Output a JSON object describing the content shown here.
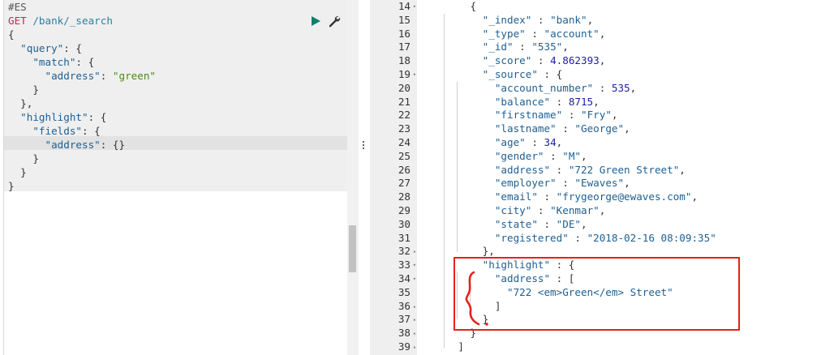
{
  "left_editor": {
    "lines": [
      [
        {
          "t": "#ES",
          "c": "comment"
        }
      ],
      [
        {
          "t": "GET",
          "c": "method"
        },
        {
          "t": " /bank/_search",
          "c": "url"
        }
      ],
      [
        {
          "t": "{",
          "c": "punc"
        }
      ],
      [
        {
          "t": "  \"query\"",
          "c": "key"
        },
        {
          "t": ": {",
          "c": "punc"
        }
      ],
      [
        {
          "t": "    \"match\"",
          "c": "key"
        },
        {
          "t": ": {",
          "c": "punc"
        }
      ],
      [
        {
          "t": "      \"address\"",
          "c": "key"
        },
        {
          "t": ": ",
          "c": "punc"
        },
        {
          "t": "\"green\"",
          "c": "str"
        }
      ],
      [
        {
          "t": "    }",
          "c": "punc"
        }
      ],
      [
        {
          "t": "  },",
          "c": "punc"
        }
      ],
      [
        {
          "t": "  \"highlight\"",
          "c": "key"
        },
        {
          "t": ": {",
          "c": "punc"
        }
      ],
      [
        {
          "t": "    \"fields\"",
          "c": "key"
        },
        {
          "t": ": {",
          "c": "punc"
        }
      ],
      [
        {
          "t": "      \"address\"",
          "c": "key"
        },
        {
          "t": ": {}",
          "c": "punc"
        }
      ],
      [
        {
          "t": "    }",
          "c": "punc"
        }
      ],
      [
        {
          "t": "  }",
          "c": "punc"
        }
      ],
      [
        {
          "t": "}",
          "c": "punc"
        }
      ]
    ],
    "run_icon": "play-icon",
    "settings_icon": "wrench-icon"
  },
  "right_editor": {
    "lines": [
      {
        "n": "14",
        "fold": "▾",
        "segs": [
          {
            "t": "      {",
            "c": "punc"
          }
        ]
      },
      {
        "n": "15",
        "fold": "",
        "segs": [
          {
            "t": "        \"_index\"",
            "c": "key"
          },
          {
            "t": " : ",
            "c": "punc"
          },
          {
            "t": "\"bank\"",
            "c": "str"
          },
          {
            "t": ",",
            "c": "punc"
          }
        ]
      },
      {
        "n": "16",
        "fold": "",
        "segs": [
          {
            "t": "        \"_type\"",
            "c": "key"
          },
          {
            "t": " : ",
            "c": "punc"
          },
          {
            "t": "\"account\"",
            "c": "str"
          },
          {
            "t": ",",
            "c": "punc"
          }
        ]
      },
      {
        "n": "17",
        "fold": "",
        "segs": [
          {
            "t": "        \"_id\"",
            "c": "key"
          },
          {
            "t": " : ",
            "c": "punc"
          },
          {
            "t": "\"535\"",
            "c": "str"
          },
          {
            "t": ",",
            "c": "punc"
          }
        ]
      },
      {
        "n": "18",
        "fold": "",
        "segs": [
          {
            "t": "        \"_score\"",
            "c": "key"
          },
          {
            "t": " : ",
            "c": "punc"
          },
          {
            "t": "4.862393",
            "c": "num"
          },
          {
            "t": ",",
            "c": "punc"
          }
        ]
      },
      {
        "n": "19",
        "fold": "▾",
        "segs": [
          {
            "t": "        \"_source\"",
            "c": "key"
          },
          {
            "t": " : {",
            "c": "punc"
          }
        ]
      },
      {
        "n": "20",
        "fold": "",
        "segs": [
          {
            "t": "          \"account_number\"",
            "c": "key"
          },
          {
            "t": " : ",
            "c": "punc"
          },
          {
            "t": "535",
            "c": "num"
          },
          {
            "t": ",",
            "c": "punc"
          }
        ]
      },
      {
        "n": "21",
        "fold": "",
        "segs": [
          {
            "t": "          \"balance\"",
            "c": "key"
          },
          {
            "t": " : ",
            "c": "punc"
          },
          {
            "t": "8715",
            "c": "num"
          },
          {
            "t": ",",
            "c": "punc"
          }
        ]
      },
      {
        "n": "22",
        "fold": "",
        "segs": [
          {
            "t": "          \"firstname\"",
            "c": "key"
          },
          {
            "t": " : ",
            "c": "punc"
          },
          {
            "t": "\"Fry\"",
            "c": "str"
          },
          {
            "t": ",",
            "c": "punc"
          }
        ]
      },
      {
        "n": "23",
        "fold": "",
        "segs": [
          {
            "t": "          \"lastname\"",
            "c": "key"
          },
          {
            "t": " : ",
            "c": "punc"
          },
          {
            "t": "\"George\"",
            "c": "str"
          },
          {
            "t": ",",
            "c": "punc"
          }
        ]
      },
      {
        "n": "24",
        "fold": "",
        "segs": [
          {
            "t": "          \"age\"",
            "c": "key"
          },
          {
            "t": " : ",
            "c": "punc"
          },
          {
            "t": "34",
            "c": "num"
          },
          {
            "t": ",",
            "c": "punc"
          }
        ]
      },
      {
        "n": "25",
        "fold": "",
        "segs": [
          {
            "t": "          \"gender\"",
            "c": "key"
          },
          {
            "t": " : ",
            "c": "punc"
          },
          {
            "t": "\"M\"",
            "c": "str"
          },
          {
            "t": ",",
            "c": "punc"
          }
        ]
      },
      {
        "n": "26",
        "fold": "",
        "segs": [
          {
            "t": "          \"address\"",
            "c": "key"
          },
          {
            "t": " : ",
            "c": "punc"
          },
          {
            "t": "\"722 Green Street\"",
            "c": "str"
          },
          {
            "t": ",",
            "c": "punc"
          }
        ]
      },
      {
        "n": "27",
        "fold": "",
        "segs": [
          {
            "t": "          \"employer\"",
            "c": "key"
          },
          {
            "t": " : ",
            "c": "punc"
          },
          {
            "t": "\"Ewaves\"",
            "c": "str"
          },
          {
            "t": ",",
            "c": "punc"
          }
        ]
      },
      {
        "n": "28",
        "fold": "",
        "segs": [
          {
            "t": "          \"email\"",
            "c": "key"
          },
          {
            "t": " : ",
            "c": "punc"
          },
          {
            "t": "\"frygeorge@ewaves.com\"",
            "c": "str"
          },
          {
            "t": ",",
            "c": "punc"
          }
        ]
      },
      {
        "n": "29",
        "fold": "",
        "segs": [
          {
            "t": "          \"city\"",
            "c": "key"
          },
          {
            "t": " : ",
            "c": "punc"
          },
          {
            "t": "\"Kenmar\"",
            "c": "str"
          },
          {
            "t": ",",
            "c": "punc"
          }
        ]
      },
      {
        "n": "30",
        "fold": "",
        "segs": [
          {
            "t": "          \"state\"",
            "c": "key"
          },
          {
            "t": " : ",
            "c": "punc"
          },
          {
            "t": "\"DE\"",
            "c": "str"
          },
          {
            "t": ",",
            "c": "punc"
          }
        ]
      },
      {
        "n": "31",
        "fold": "",
        "segs": [
          {
            "t": "          \"registered\"",
            "c": "key"
          },
          {
            "t": " : ",
            "c": "punc"
          },
          {
            "t": "\"2018-02-16 08:09:35\"",
            "c": "str"
          }
        ]
      },
      {
        "n": "32",
        "fold": "▴",
        "segs": [
          {
            "t": "        },",
            "c": "punc"
          }
        ]
      },
      {
        "n": "33",
        "fold": "▾",
        "segs": [
          {
            "t": "        \"highlight\"",
            "c": "key"
          },
          {
            "t": " : {",
            "c": "punc"
          }
        ]
      },
      {
        "n": "34",
        "fold": "▾",
        "segs": [
          {
            "t": "          \"address\"",
            "c": "key"
          },
          {
            "t": " : [",
            "c": "punc"
          }
        ]
      },
      {
        "n": "35",
        "fold": "",
        "segs": [
          {
            "t": "            \"722 <em>Green</em> Street\"",
            "c": "str"
          }
        ]
      },
      {
        "n": "36",
        "fold": "▴",
        "segs": [
          {
            "t": "          ]",
            "c": "punc"
          }
        ]
      },
      {
        "n": "37",
        "fold": "▴",
        "segs": [
          {
            "t": "        }",
            "c": "punc"
          }
        ]
      },
      {
        "n": "38",
        "fold": "▴",
        "segs": [
          {
            "t": "      }",
            "c": "punc"
          }
        ]
      },
      {
        "n": "39",
        "fold": "▴",
        "segs": [
          {
            "t": "    ]",
            "c": "punc"
          }
        ]
      }
    ]
  },
  "annotation": {
    "box_color": "#e3221c",
    "icon": "brace-annotation-icon"
  }
}
